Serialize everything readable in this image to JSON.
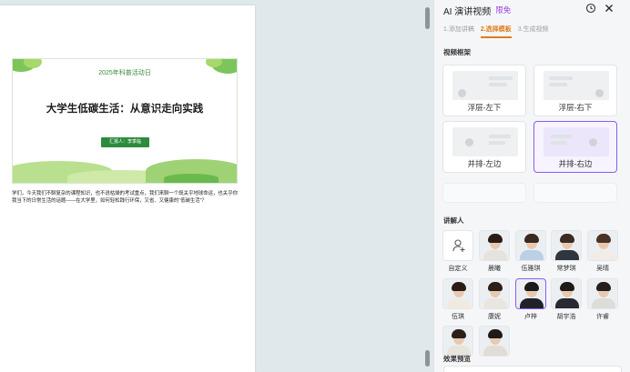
{
  "document": {
    "slide": {
      "date": "2025年科普活动日",
      "title": "大学生低碳生活：从意识走向实践",
      "reporter": "汇报人：李季临"
    },
    "body_text": "学们，今天我们不聊复杂的课程知识，也不说枯燥的考试重点，我们来聊一个既关乎地球命运，也关乎你我当下的日常生活的话题——在大学里，如何轻松践行环保，又省、又健康的“低碳生活”？"
  },
  "panel": {
    "title": "AI 演讲视频",
    "badge": "限免",
    "history_icon": "history-icon",
    "close_icon": "close-icon",
    "steps": [
      "1.添加讲稿",
      "2.选择模板",
      "3.生成视频"
    ],
    "active_step": 1,
    "frame_section_title": "视频框架",
    "frames": [
      {
        "label": "浮层-左下",
        "layout": "float-left"
      },
      {
        "label": "浮层-右下",
        "layout": "float-right"
      },
      {
        "label": "并排-左边",
        "layout": "side-left"
      },
      {
        "label": "并排-右边",
        "layout": "side-right"
      }
    ],
    "selected_frame": 3,
    "presenter_section_title": "讲解人",
    "presenters": [
      {
        "name": "自定义",
        "custom": true
      },
      {
        "name": "晨曦",
        "hair": "#2b1d16",
        "body": "#e6e2dc"
      },
      {
        "name": "伍雅琪",
        "hair": "#3a2a20",
        "body": "#b9d0e6"
      },
      {
        "name": "常梦琪",
        "hair": "#3b2b22",
        "body": "#2f3640"
      },
      {
        "name": "吴晴",
        "hair": "#4a3426",
        "body": "#f1ece6"
      },
      {
        "name": "伍琪",
        "hair": "#2a1c15",
        "body": "#f0eae2"
      },
      {
        "name": "康妮",
        "hair": "#2d1f18",
        "body": "#e9e6e0"
      },
      {
        "name": "卢梓",
        "hair": "#1c1a19",
        "body": "#1f2329"
      },
      {
        "name": "胡宇浩",
        "hair": "#1d1a18",
        "body": "#272b31"
      },
      {
        "name": "许睿",
        "hair": "#241f1c",
        "body": "#dcdcd8"
      },
      {
        "name": "",
        "hair": "#2a1f19",
        "body": "#e7e3dd"
      },
      {
        "name": "",
        "hair": "#201b18",
        "body": "#e1ddd6"
      }
    ],
    "selected_presenter": 7,
    "preview_section_title": "效果预览"
  },
  "colors": {
    "accent": "#8b5cf6",
    "step_active": "#e07c1a",
    "badge": "#a040e0",
    "slide_green": "#2c8c3e"
  }
}
